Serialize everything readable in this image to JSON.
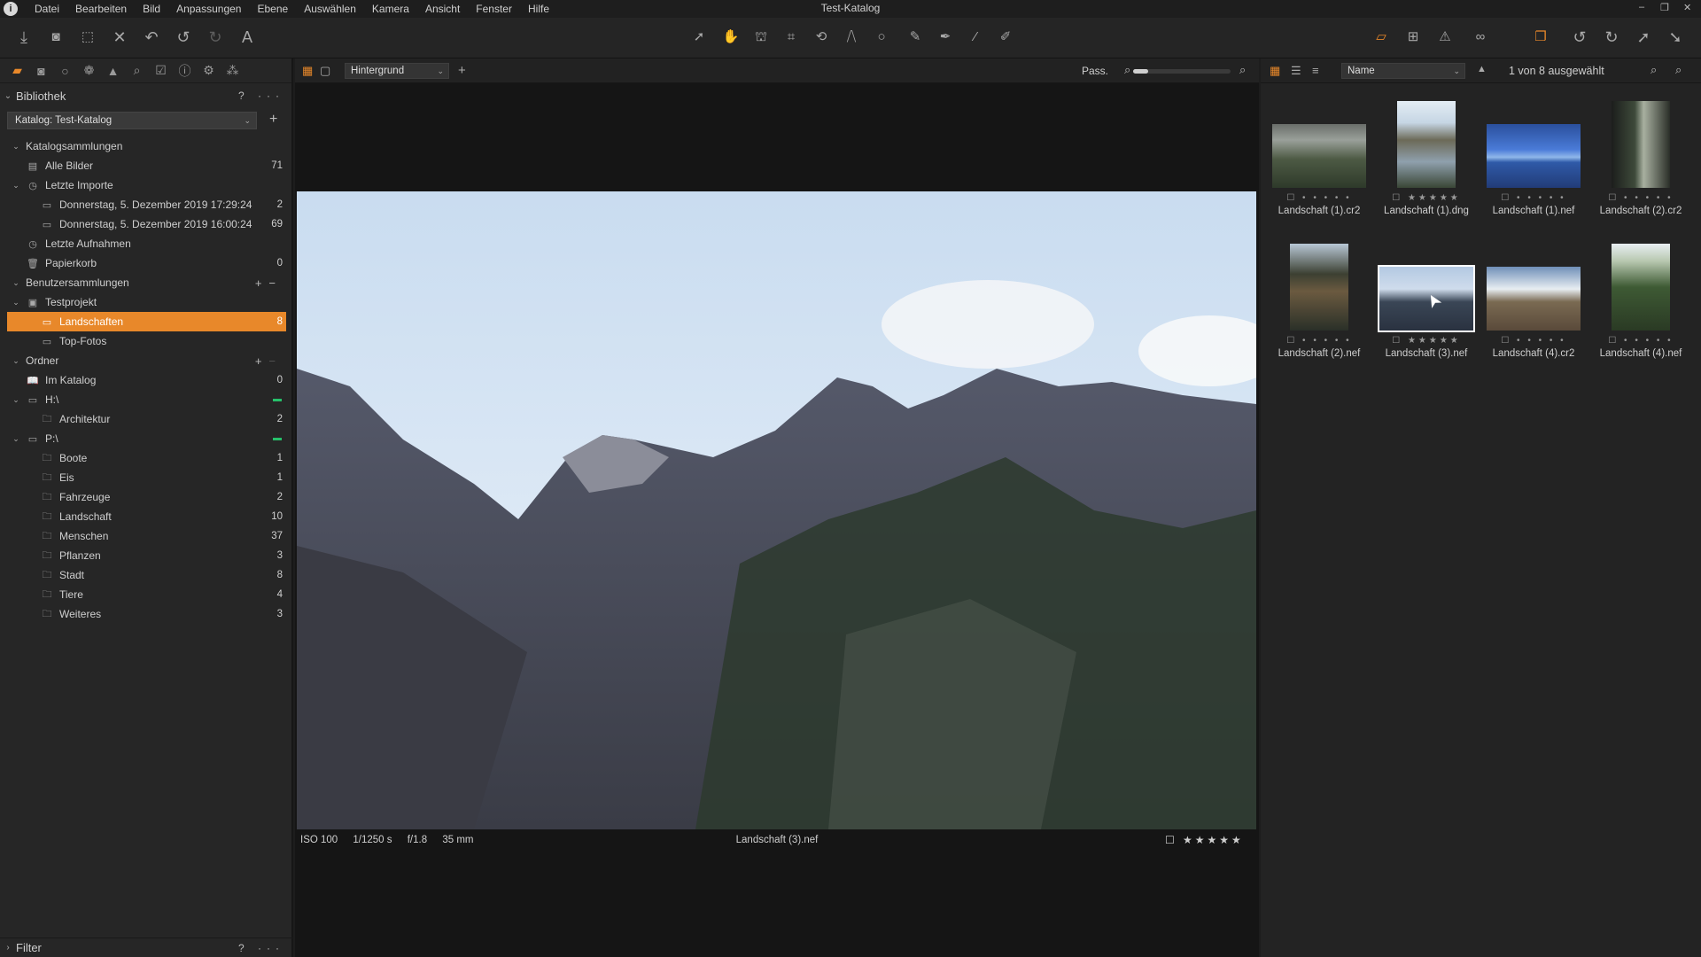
{
  "window": {
    "title": "Test-Katalog",
    "menu": [
      "Datei",
      "Bearbeiten",
      "Bild",
      "Anpassungen",
      "Ebene",
      "Auswählen",
      "Kamera",
      "Ansicht",
      "Fenster",
      "Hilfe"
    ],
    "controls": {
      "minimize": "–",
      "restore": "❐",
      "close": "✕"
    }
  },
  "colors": {
    "accent": "#e8882a",
    "selected_row": "#e8882a",
    "online_indicator": "#26c06a"
  },
  "library": {
    "title": "Bibliothek",
    "help": "?",
    "more": "···",
    "catalog_select": "Katalog: Test-Katalog",
    "sections": {
      "catalog_collections": "Katalogsammlungen",
      "all_images": {
        "label": "Alle Bilder",
        "count": "71"
      },
      "recent_imports": "Letzte Importe",
      "imports": [
        {
          "label": "Donnerstag, 5. Dezember 2019 17:29:24",
          "count": "2"
        },
        {
          "label": "Donnerstag, 5. Dezember 2019 16:00:24",
          "count": "69"
        }
      ],
      "recent_captures": "Letzte Aufnahmen",
      "trash": {
        "label": "Papierkorb",
        "count": "0"
      },
      "user_collections": "Benutzersammlungen",
      "project": "Testprojekt",
      "project_items": [
        {
          "label": "Landschaften",
          "count": "8"
        },
        {
          "label": "Top-Fotos",
          "count": ""
        }
      ],
      "folders": "Ordner",
      "in_catalog": {
        "label": "Im Katalog",
        "count": "0"
      },
      "drive_h": "H:\\",
      "drive_h_items": [
        {
          "label": "Architektur",
          "count": "2"
        }
      ],
      "drive_p": "P:\\",
      "drive_p_items": [
        {
          "label": "Boote",
          "count": "1"
        },
        {
          "label": "Eis",
          "count": "1"
        },
        {
          "label": "Fahrzeuge",
          "count": "2"
        },
        {
          "label": "Landschaft",
          "count": "10"
        },
        {
          "label": "Menschen",
          "count": "37"
        },
        {
          "label": "Pflanzen",
          "count": "3"
        },
        {
          "label": "Stadt",
          "count": "8"
        },
        {
          "label": "Tiere",
          "count": "4"
        },
        {
          "label": "Weiteres",
          "count": "3"
        }
      ]
    },
    "filter_title": "Filter"
  },
  "viewer": {
    "background_select": "Hintergrund",
    "fit_label": "Pass.",
    "zoom_level": 0.15,
    "iso": "ISO 100",
    "shutter": "1/1250 s",
    "aperture": "f/1.8",
    "focal": "35 mm",
    "filename": "Landschaft (3).nef",
    "rating": "★★★★★"
  },
  "browser": {
    "sort_select": "Name",
    "sort_dir": "▲",
    "selection_status": "1 von 8 ausgewählt",
    "thumbnails": [
      {
        "name": "Landschaft (1).cr2",
        "rating": "☐ • • • • •"
      },
      {
        "name": "Landschaft (1).dng",
        "rating": "☐ ★★★★★"
      },
      {
        "name": "Landschaft (1).nef",
        "rating": "☐ • • • • •"
      },
      {
        "name": "Landschaft (2).cr2",
        "rating": "☐ • • • • •"
      },
      {
        "name": "Landschaft (2).nef",
        "rating": "☐ • • • • •"
      },
      {
        "name": "Landschaft (3).nef",
        "rating": "☐ ★★★★★"
      },
      {
        "name": "Landschaft (4).cr2",
        "rating": "☐ • • • • •"
      },
      {
        "name": "Landschaft (4).nef",
        "rating": "☐ • • • • •"
      }
    ]
  }
}
